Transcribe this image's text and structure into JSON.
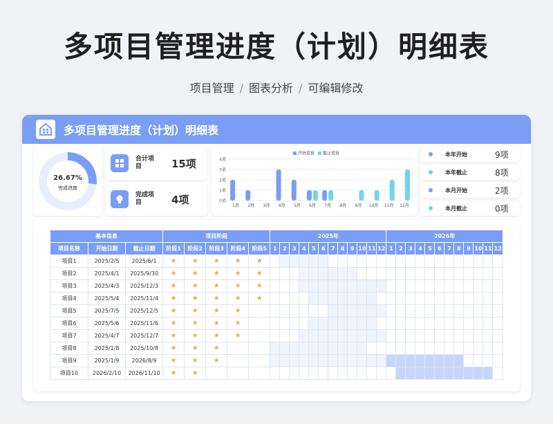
{
  "page": {
    "title": "多项目管理进度（计划）明细表",
    "subtitle": [
      "项目管理",
      "图表分析",
      "可编辑修改"
    ],
    "separator": "/"
  },
  "panel": {
    "title": "多项目管理进度（计划）明细表"
  },
  "summary": {
    "completion_rate": "26.67%",
    "completion_fraction": 0.2667,
    "completion_label": "完成进度",
    "total_label": "合计项目",
    "total_value": "15项",
    "done_label": "完成项目",
    "done_value": "4项"
  },
  "kpis": [
    {
      "label": "本年开始",
      "value": "9项",
      "color": "#7a9ef5"
    },
    {
      "label": "本年截止",
      "value": "8项",
      "color": "#6fd5ee"
    },
    {
      "label": "本月开始",
      "value": "2项",
      "color": "#7a9ef5"
    },
    {
      "label": "本月截止",
      "value": "0项",
      "color": "#6fd5ee"
    }
  ],
  "chart_data": {
    "type": "bar",
    "categories": [
      "1月",
      "2月",
      "3月",
      "4月",
      "5月",
      "6月",
      "7月",
      "8月",
      "9月",
      "10月",
      "11月",
      "12月"
    ],
    "series": [
      {
        "name": "开始项目",
        "values": [
          2,
          1,
          0,
          3,
          2,
          1,
          1,
          0,
          0,
          0,
          0,
          0
        ],
        "color": "#7a9ef5"
      },
      {
        "name": "截止项目",
        "values": [
          0,
          0,
          0,
          0,
          0,
          1,
          1,
          0,
          1,
          1,
          2,
          3
        ],
        "color": "#6fd5ee"
      }
    ],
    "y_ticks": [
      "0项",
      "1项",
      "2项",
      "3项",
      "4项"
    ],
    "ylim": [
      0,
      4
    ],
    "legend": "top"
  },
  "table": {
    "group_headers": [
      "基本信息",
      "项目阶段",
      "2025年",
      "2026年"
    ],
    "columns": [
      "项目名称",
      "开始日期",
      "截止日期",
      "阶段1",
      "阶段2",
      "阶段3",
      "阶段4",
      "阶段5"
    ],
    "months": [
      "1",
      "2",
      "3",
      "4",
      "5",
      "6",
      "7",
      "8",
      "9",
      "10",
      "11",
      "12"
    ],
    "star_glyph": "★",
    "rows": [
      {
        "name": "项目1",
        "start": "2025/2/5",
        "end": "2025/6/1",
        "stages": 5
      },
      {
        "name": "项目2",
        "start": "2025/4/1",
        "end": "2025/9/30",
        "stages": 5
      },
      {
        "name": "项目3",
        "start": "2025/4/3",
        "end": "2025/12/3",
        "stages": 5
      },
      {
        "name": "项目4",
        "start": "2025/5/4",
        "end": "2025/11/4",
        "stages": 5
      },
      {
        "name": "项目5",
        "start": "2025/7/5",
        "end": "2025/12/5",
        "stages": 4
      },
      {
        "name": "项目6",
        "start": "2025/5/6",
        "end": "2025/11/6",
        "stages": 4
      },
      {
        "name": "项目7",
        "start": "2025/4/7",
        "end": "2025/12/7",
        "stages": 4
      },
      {
        "name": "项目8",
        "start": "2025/1/8",
        "end": "2025/10/8",
        "stages": 3
      },
      {
        "name": "项目9",
        "start": "2025/1/9",
        "end": "2026/8/9",
        "stages": 3
      },
      {
        "name": "项目10",
        "start": "2026/2/10",
        "end": "2026/11/10",
        "stages": 2
      }
    ]
  },
  "icons": {
    "logo": "building-icon",
    "total": "grid-icon",
    "done": "lightbulb-icon"
  }
}
